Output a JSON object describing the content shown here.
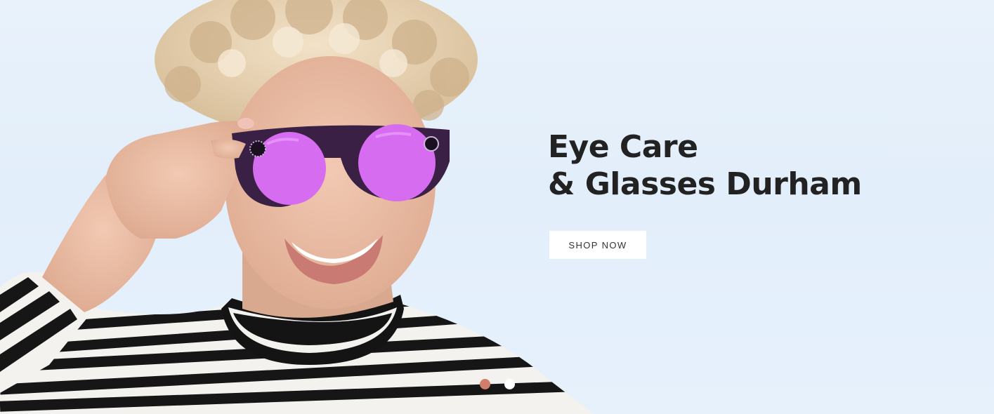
{
  "hero": {
    "title_line1": "Eye Care",
    "title_line2": "& Glasses Durham",
    "cta_label": "SHOP NOW"
  },
  "slider": {
    "slide_count": 2,
    "active_index": 0
  },
  "colors": {
    "title": "#222222",
    "background": "#e6f0fa",
    "dot_active": "#d17d6b",
    "dot_inactive": "#ffffff",
    "lens": "#d66cf0",
    "frame": "#3a2045"
  }
}
